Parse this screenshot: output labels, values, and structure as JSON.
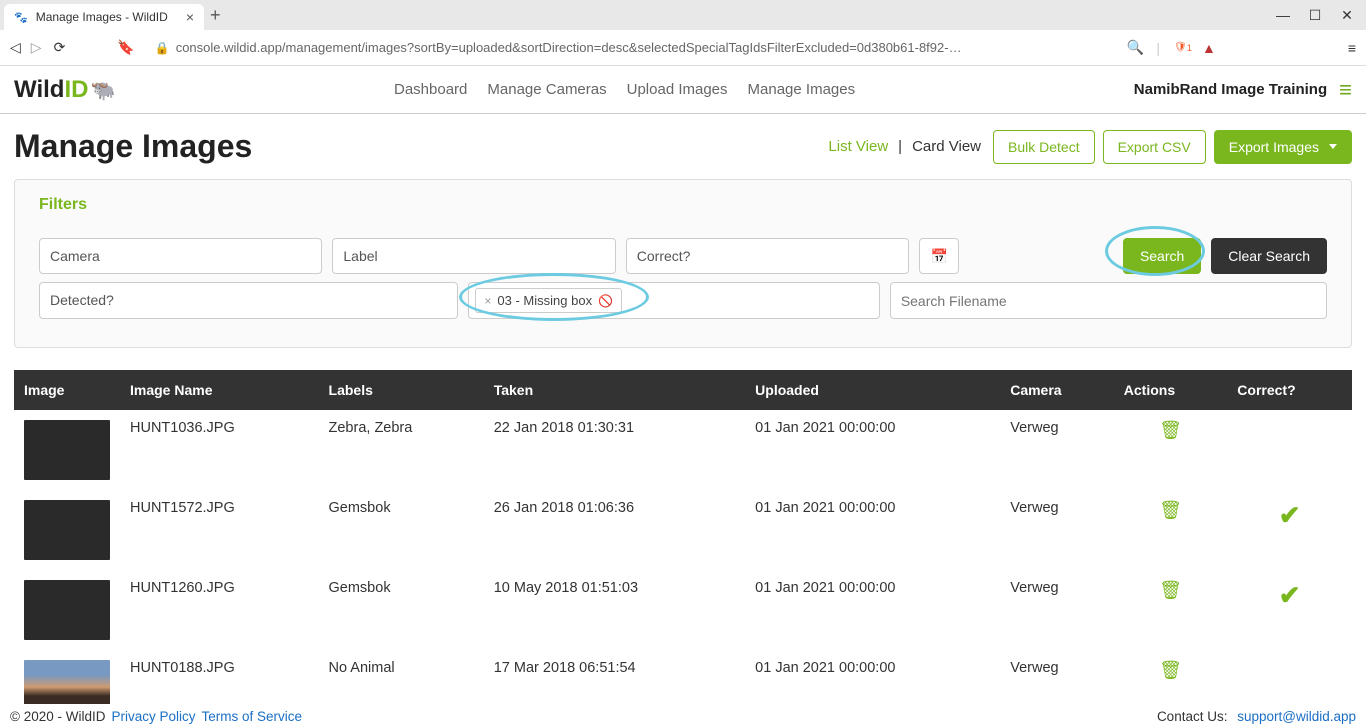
{
  "browser": {
    "tab_title": "Manage Images - WildID",
    "url": "console.wildid.app/management/images?sortBy=uploaded&sortDirection=desc&selectedSpecialTagIdsFilterExcluded=0d380b61-8f92-…",
    "brave_badge": "1"
  },
  "header": {
    "logo_wild": "Wild",
    "logo_id": "ID",
    "nav": [
      "Dashboard",
      "Manage Cameras",
      "Upload Images",
      "Manage Images"
    ],
    "project": "NamibRand Image Training"
  },
  "page": {
    "title": "Manage Images",
    "views": {
      "list": "List View",
      "card": "Card View"
    },
    "actions": {
      "bulk_detect": "Bulk Detect",
      "export_csv": "Export CSV",
      "export_images": "Export Images"
    }
  },
  "filters": {
    "title": "Filters",
    "camera_ph": "Camera",
    "label_ph": "Label",
    "correct_ph": "Correct?",
    "detected_ph": "Detected?",
    "tag_chip": "03 - Missing box",
    "filename_ph": "Search Filename",
    "search_btn": "Search",
    "clear_btn": "Clear Search"
  },
  "table": {
    "headers": {
      "image": "Image",
      "image_name": "Image Name",
      "labels": "Labels",
      "taken": "Taken",
      "uploaded": "Uploaded",
      "camera": "Camera",
      "actions": "Actions",
      "correct": "Correct?"
    },
    "rows": [
      {
        "name": "HUNT1036.JPG",
        "labels": "Zebra, Zebra",
        "taken": "22 Jan 2018 01:30:31",
        "uploaded": "01 Jan 2021 00:00:00",
        "camera": "Verweg",
        "correct": false,
        "thumb": "dark"
      },
      {
        "name": "HUNT1572.JPG",
        "labels": "Gemsbok",
        "taken": "26 Jan 2018 01:06:36",
        "uploaded": "01 Jan 2021 00:00:00",
        "camera": "Verweg",
        "correct": true,
        "thumb": "dark"
      },
      {
        "name": "HUNT1260.JPG",
        "labels": "Gemsbok",
        "taken": "10 May 2018 01:51:03",
        "uploaded": "01 Jan 2021 00:00:00",
        "camera": "Verweg",
        "correct": true,
        "thumb": "dark"
      },
      {
        "name": "HUNT0188.JPG",
        "labels": "No Animal",
        "taken": "17 Mar 2018 06:51:54",
        "uploaded": "01 Jan 2021 00:00:00",
        "camera": "Verweg",
        "correct": false,
        "thumb": "dusk"
      }
    ]
  },
  "footer": {
    "copyright": "© 2020 - WildID",
    "privacy": "Privacy Policy",
    "terms": "Terms of Service",
    "contact_label": "Contact Us: ",
    "contact_email": "support@wildid.app"
  }
}
